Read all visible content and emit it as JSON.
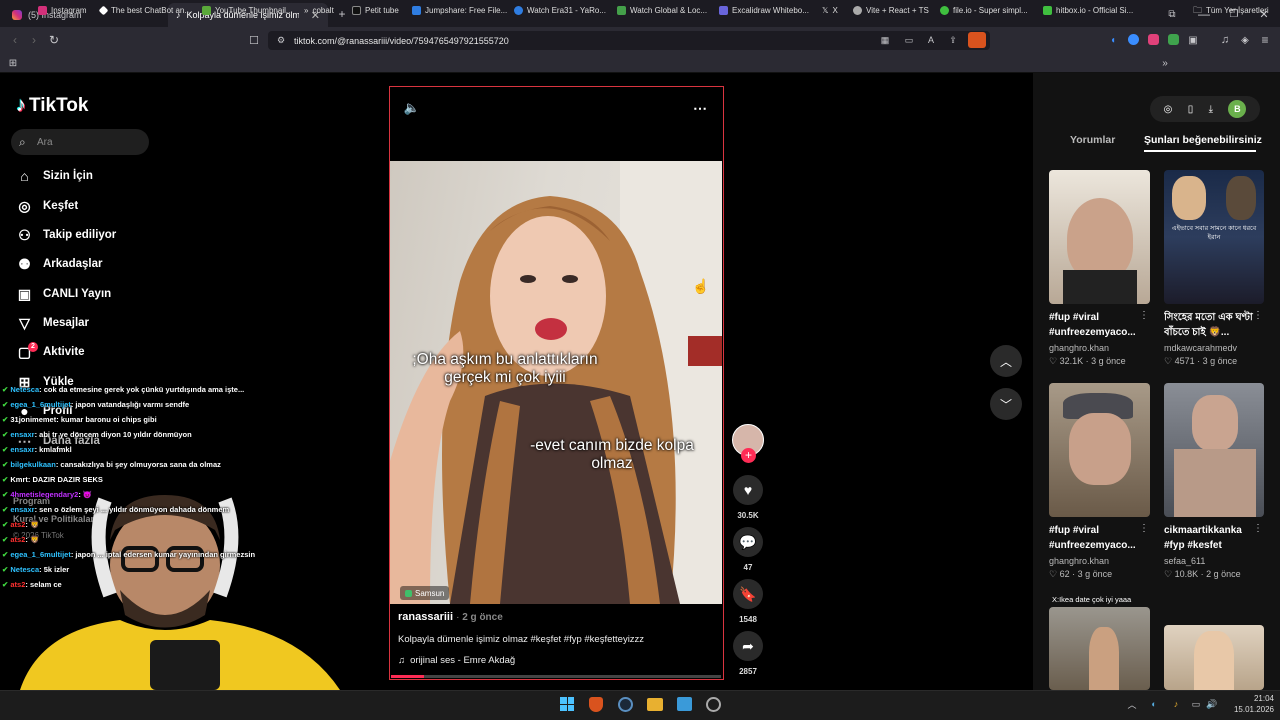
{
  "browser": {
    "tabs": [
      {
        "label": "(5) Instagram"
      },
      {
        "label": "Kolpayla dümenle işimiz olmaz"
      }
    ],
    "url": "tiktok.com/@ranassariii/video/7594765497921555720",
    "bookmarks": [
      "Instagram",
      "The best ChatBot an...",
      "YouTube Thumbnail...",
      "cobalt",
      "Petit tube",
      "Jumpshare: Free File...",
      "Watch Era31 - YaRo...",
      "Watch Global & Loc...",
      "Excalidraw Whitebo...",
      "X",
      "Vite + React + TS",
      "file.io - Super simpl...",
      "hitbox.io - Official Si..."
    ],
    "all_bookmarks": "Tüm Yer İşaretleri"
  },
  "sidebar": {
    "brand": "TikTok",
    "search_placeholder": "Ara",
    "items": [
      {
        "label": "Sizin İçin",
        "icon": "home-icon"
      },
      {
        "label": "Keşfet",
        "icon": "compass-icon"
      },
      {
        "label": "Takip ediliyor",
        "icon": "following-icon"
      },
      {
        "label": "Arkadaşlar",
        "icon": "friends-icon"
      },
      {
        "label": "CANLI Yayın",
        "icon": "live-icon"
      },
      {
        "label": "Mesajlar",
        "icon": "messages-icon"
      },
      {
        "label": "Aktivite",
        "icon": "activity-icon",
        "badge": "2"
      },
      {
        "label": "Yükle",
        "icon": "upload-icon"
      },
      {
        "label": "Profil",
        "icon": "profile-icon"
      },
      {
        "label": "Daha fazla",
        "icon": "more-icon"
      }
    ],
    "footer": [
      "Program",
      "Kural ve Politikalar",
      "© 2026 TikTok"
    ]
  },
  "video": {
    "caption1": ";Oha aşkım bu anlattıkların gerçek mi çok iyiii",
    "caption2": "-evet canım bizde kolpa olmaz",
    "location": "Samsun",
    "author": "ranassariii",
    "time": "2 g önce",
    "description": "Kolpayla dümenle işimiz olmaz #keşfet #fyp #keşfetteyizzz",
    "sound": "orijinal ses - Emre Akdağ",
    "progress": 0.1
  },
  "actions": {
    "likes": "30.5K",
    "comments": "47",
    "saves": "1548",
    "shares": "2857"
  },
  "right": {
    "tabs": [
      "Yorumlar",
      "Şunları beğenebilirsiniz"
    ],
    "cards": [
      {
        "title": "#fup #viral #unfreezemyaco...",
        "user": "ghanghro.khan",
        "likes": "32.1K",
        "time": "3 g önce",
        "thumb_color": "#9a8572"
      },
      {
        "title": "সিংহের মতো এক ঘণ্টা বাঁচতে চাই 🦁...",
        "user": "mdkawcarahmedv",
        "likes": "4571",
        "time": "3 g önce",
        "thumb_color": "#2a3550"
      },
      {
        "title": "#fup #viral #unfreezemyaco...",
        "user": "ghanghro.khan",
        "likes": "62",
        "time": "3 g önce",
        "thumb_color": "#8a7a6a"
      },
      {
        "title": "cikmaartikkanka #fyp #kesfet",
        "user": "sefaa_611",
        "likes": "10.8K",
        "time": "2 g önce",
        "thumb_color": "#6b6f78"
      },
      {
        "title": "",
        "user": "",
        "likes": "",
        "time": "",
        "thumb_color": "#8c8575",
        "overlay": "X:Ikea date çok iyi yaaa"
      },
      {
        "title": "",
        "user": "",
        "likes": "",
        "time": "",
        "thumb_color": "#c9b9a0"
      }
    ],
    "thumb2_overlay": "এইভাবে সবার সামনে কানে ধরবে ইরান"
  },
  "chat": [
    {
      "user": "Netesca",
      "text": ": cok da etmesine gerek yok çünkü yurtdışında ama işte...",
      "color": "#2ec2ff"
    },
    {
      "user": "egea_1_6multijet",
      "text": ": japon vatandaşlığı varmı sendfe",
      "color": "#2ec2ff"
    },
    {
      "user": "31jonimemet",
      "text": ": kumar baronu oi chips gibi",
      "color": "#ffffff"
    },
    {
      "user": "ensaxr",
      "text": ": abi tr ye döncem diyon 10 yıldır dönmüyon",
      "color": "#2ec2ff"
    },
    {
      "user": "ensaxr",
      "text": ": kmlafmkl",
      "color": "#2ec2ff"
    },
    {
      "user": "bilgekulkaan",
      "text": ": cansakızlıya bi şey olmuyorsa sana da olmaz",
      "color": "#2ec2ff"
    },
    {
      "user": "Kmrt",
      "text": ": DAZIR DAZIR SEKS",
      "color": "#ffffff"
    },
    {
      "user": "4hmetislegendary2",
      "text": ": 😈",
      "color": "#c030ff"
    },
    {
      "user": "ensaxr",
      "text": ": sen o özlem şeyi ... yıldır dönmüyon dahada dönmem",
      "color": "#2ec2ff"
    },
    {
      "user": "ats2",
      "text": ": 🦁",
      "color": "#ff3030"
    },
    {
      "user": "ats2",
      "text": ": 🦁",
      "color": "#ff3030"
    },
    {
      "user": "egea_1_6multijet",
      "text": ": japon ... iptal edersen kumar yayınından girmezsin",
      "color": "#2ec2ff"
    },
    {
      "user": "Netesca",
      "text": ": 5k izler",
      "color": "#2ec2ff"
    },
    {
      "user": "ats2",
      "text": ": selam ce",
      "color": "#ff3030"
    }
  ],
  "taskbar": {
    "time": "21:04",
    "date": "15.01.2026"
  },
  "colors": {
    "accent": "#fe2c55",
    "border": "#d9343f",
    "avatar": "#6ab04c"
  }
}
